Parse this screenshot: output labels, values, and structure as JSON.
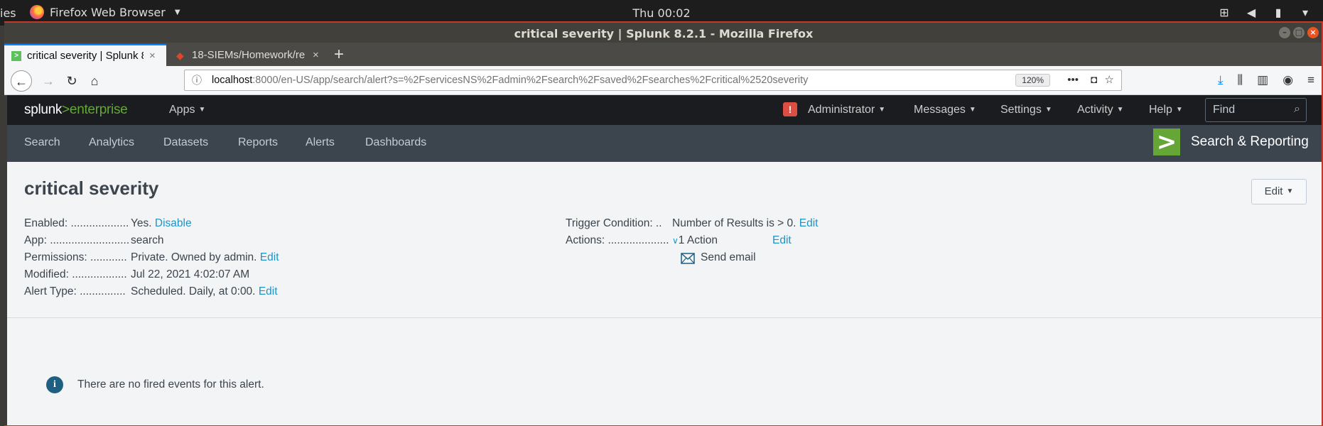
{
  "gnome": {
    "activities": "ies",
    "app_menu": "Firefox Web Browser",
    "clock": "Thu 00:02"
  },
  "window": {
    "title": "critical severity | Splunk 8.2.1 - Mozilla Firefox"
  },
  "tabs": [
    {
      "label": "critical severity | Splunk 8",
      "active": true
    },
    {
      "label": "18-SIEMs/Homework/re",
      "active": false
    }
  ],
  "urlbar": {
    "host": "localhost",
    "rest": ":8000/en-US/app/search/alert?s=%2FservicesNS%2Fadmin%2Fsearch%2Fsaved%2Fsearches%2Fcritical%2520severity",
    "zoom": "120%"
  },
  "appbar": {
    "logo_a": "splunk",
    "logo_gt": ">",
    "logo_b": "enterprise",
    "apps": "Apps",
    "menus": [
      "Administrator",
      "Messages",
      "Settings",
      "Activity",
      "Help"
    ],
    "alert_badge": "!",
    "find_placeholder": "Find"
  },
  "nav": {
    "items": [
      "Search",
      "Analytics",
      "Datasets",
      "Reports",
      "Alerts",
      "Dashboards"
    ],
    "app_logo": ">",
    "app_name": "Search & Reporting"
  },
  "alert": {
    "title": "critical severity",
    "edit_button": "Edit",
    "left": [
      {
        "label": "Enabled: ...................",
        "value": "Yes.",
        "link": "Disable"
      },
      {
        "label": "App: ..........................",
        "value": "search",
        "link": ""
      },
      {
        "label": "Permissions: ............",
        "value": "Private. Owned by admin.",
        "link": "Edit"
      },
      {
        "label": "Modified: ..................",
        "value": "Jul 22, 2021 4:02:07 AM",
        "link": ""
      },
      {
        "label": "Alert Type: ...............",
        "value": "Scheduled. Daily, at 0:00.",
        "link": "Edit"
      }
    ],
    "trigger_label": "Trigger Condition: ..",
    "trigger_value": "Number of Results is > 0.",
    "trigger_link": "Edit",
    "actions_label": "Actions: ....................",
    "actions_value": "1 Action",
    "actions_link": "Edit",
    "action_item": "Send email",
    "notice": "There are no fired events for this alert."
  }
}
